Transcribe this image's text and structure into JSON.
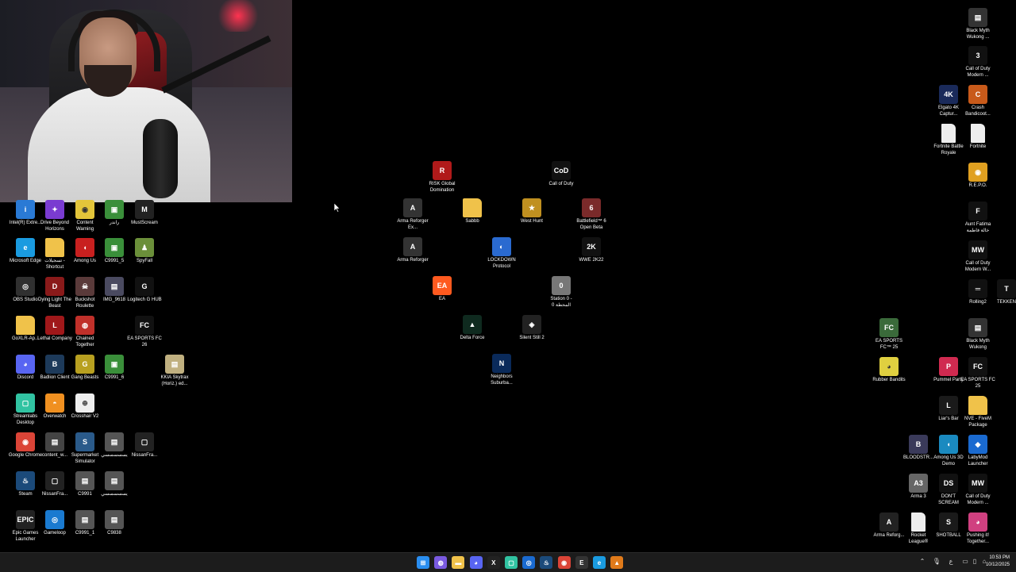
{
  "colors": {
    "desktop": "#000000",
    "taskbar": "#1c1c1c"
  },
  "left_icons": [
    {
      "label": "Intel(R) Extre...",
      "icon": "intel-icon",
      "color": "#2a7ad5",
      "glyph": "i"
    },
    {
      "label": "Drive Beyond Horizons",
      "icon": "drive-beyond-horizons-icon",
      "color": "#7a3bd1",
      "glyph": "✦"
    },
    {
      "label": "Content Warning",
      "icon": "content-warning-icon",
      "color": "#e3c53a",
      "glyph": "◉"
    },
    {
      "label": "راندر",
      "icon": "video-file-icon",
      "color": "#3a8f3a",
      "glyph": "▣"
    },
    {
      "label": "MustScream",
      "icon": "mustscream-icon",
      "color": "#222",
      "glyph": "M"
    },
    {
      "label": "Microsoft Edge",
      "icon": "edge-icon",
      "color": "#1a9be0",
      "glyph": "e"
    },
    {
      "label": "تسجيلات - Shortcut",
      "icon": "folder-icon",
      "color": "#f0c24a",
      "glyph": ""
    },
    {
      "label": "Among Us",
      "icon": "among-us-icon",
      "color": "#c8201f",
      "glyph": "◖"
    },
    {
      "label": "C9991_5",
      "icon": "video-file-icon",
      "color": "#3a8f3a",
      "glyph": "▣"
    },
    {
      "label": "SpyFall",
      "icon": "spyfall-icon",
      "color": "#6b8f3a",
      "glyph": "♟"
    },
    {
      "label": "OBS Studio",
      "icon": "obs-icon",
      "color": "#303030",
      "glyph": "◎"
    },
    {
      "label": "Dying Light The Beast",
      "icon": "dying-light-icon",
      "color": "#8a1a1a",
      "glyph": "D"
    },
    {
      "label": "Buckshot Roulette",
      "icon": "buckshot-roulette-icon",
      "color": "#5a3a3a",
      "glyph": "☠"
    },
    {
      "label": "IMG_9618",
      "icon": "image-file-icon",
      "color": "#4a4a60",
      "glyph": "▤"
    },
    {
      "label": "Logitech G HUB",
      "icon": "logitech-icon",
      "color": "#111",
      "glyph": "G"
    },
    {
      "label": "GoXLR-Ap...",
      "icon": "folder-icon",
      "color": "#f0c24a",
      "glyph": ""
    },
    {
      "label": "Lethal Company",
      "icon": "lethal-company-icon",
      "color": "#a0181a",
      "glyph": "L"
    },
    {
      "label": "Chained Together",
      "icon": "chained-together-icon",
      "color": "#c0302a",
      "glyph": "◍"
    },
    {
      "label": "EA SPORTS FC 26",
      "icon": "ea-fc-icon",
      "color": "#111",
      "glyph": "FC"
    },
    {
      "label": "Discord",
      "icon": "discord-icon",
      "color": "#5865f2",
      "glyph": "◕"
    },
    {
      "label": "Badlion Client",
      "icon": "badlion-icon",
      "color": "#1d3a5a",
      "glyph": "B"
    },
    {
      "label": "Gang Beasts",
      "icon": "gang-beasts-icon",
      "color": "#b8a020",
      "glyph": "G"
    },
    {
      "label": "C9991_6",
      "icon": "video-file-icon",
      "color": "#3a8f3a",
      "glyph": "▣"
    },
    {
      "label": "KKIA Skytrax (Horiz.) ed...",
      "icon": "video-file-icon",
      "color": "#c0b080",
      "glyph": "▤"
    },
    {
      "label": "Streamlabs Desktop",
      "icon": "streamlabs-icon",
      "color": "#31c3a2",
      "glyph": "▢"
    },
    {
      "label": "Overwatch",
      "icon": "overwatch-icon",
      "color": "#f09020",
      "glyph": "◓"
    },
    {
      "label": "Crosshair V2",
      "icon": "crosshair-icon",
      "color": "#eee",
      "glyph": "⊕"
    },
    {
      "label": "Google Chrome",
      "icon": "chrome-icon",
      "color": "#db4437",
      "glyph": "◉"
    },
    {
      "label": "content_w...",
      "icon": "video-file-icon",
      "color": "#444",
      "glyph": "▤"
    },
    {
      "label": "Supermarket Simulator",
      "icon": "supermarket-simulator-icon",
      "color": "#2a5a8a",
      "glyph": "S"
    },
    {
      "label": "يسسسسسي",
      "icon": "image-file-icon",
      "color": "#555",
      "glyph": "▤"
    },
    {
      "label": "NissanFra...",
      "icon": "video-file-icon",
      "color": "#222",
      "glyph": "▢"
    },
    {
      "label": "Steam",
      "icon": "steam-icon",
      "color": "#1b4a7a",
      "glyph": "♨"
    },
    {
      "label": "NissanFra...",
      "icon": "video-file-icon",
      "color": "#222",
      "glyph": "▢"
    },
    {
      "label": "C9991",
      "icon": "video-file-icon",
      "color": "#555",
      "glyph": "▤"
    },
    {
      "label": "يسسسسسي",
      "icon": "image-file-icon",
      "color": "#555",
      "glyph": "▤"
    },
    {
      "label": "Epic Games Launcher",
      "icon": "epic-games-icon",
      "color": "#222",
      "glyph": "EPIC"
    },
    {
      "label": "Gameloop",
      "icon": "gameloop-icon",
      "color": "#1a7ad0",
      "glyph": "◎"
    },
    {
      "label": "C9991_1",
      "icon": "video-file-icon",
      "color": "#555",
      "glyph": "▤"
    },
    {
      "label": "C9838",
      "icon": "video-file-icon",
      "color": "#555",
      "glyph": "▤"
    }
  ],
  "center_icons": [
    {
      "label": "RISK Global Domination",
      "icon": "risk-icon",
      "color": "#b01a1a",
      "glyph": "R"
    },
    {
      "label": "Call of Duty",
      "icon": "call-of-duty-icon",
      "color": "#111",
      "glyph": "CoD"
    },
    {
      "label": "Arma Reforger Ex...",
      "icon": "arma-reforger-icon",
      "color": "#333",
      "glyph": "A"
    },
    {
      "label": "Sabbb",
      "icon": "folder-icon",
      "color": "#f0c24a",
      "glyph": ""
    },
    {
      "label": "West Hunt",
      "icon": "west-hunt-icon",
      "color": "#c09020",
      "glyph": "★"
    },
    {
      "label": "Battlefield™ 6 Open Beta",
      "icon": "battlefield-icon",
      "color": "#7a2a2a",
      "glyph": "6"
    },
    {
      "label": "Arma Reforger",
      "icon": "arma-reforger-icon",
      "color": "#333",
      "glyph": "A"
    },
    {
      "label": "LOCKDOWN Protocol",
      "icon": "lockdown-protocol-icon",
      "color": "#2a6ad0",
      "glyph": "◐"
    },
    {
      "label": "WWE 2K22",
      "icon": "wwe-icon",
      "color": "#111",
      "glyph": "2K"
    },
    {
      "label": "EA",
      "icon": "ea-icon",
      "color": "#ff5a1f",
      "glyph": "EA"
    },
    {
      "label": "Station 0 - المحطة 0",
      "icon": "station-zero-icon",
      "color": "#777",
      "glyph": "0"
    },
    {
      "label": "Delta Force",
      "icon": "delta-force-icon",
      "color": "#0f2a1f",
      "glyph": "▲"
    },
    {
      "label": "Silent Still 2",
      "icon": "silent-still-icon",
      "color": "#222",
      "glyph": "◈"
    },
    {
      "label": "Neighbors Suburba...",
      "icon": "neighbors-icon",
      "color": "#0a2a5a",
      "glyph": "N"
    }
  ],
  "right_icons": [
    {
      "label": "Black Myth Wukong ...",
      "icon": "black-myth-icon",
      "color": "#333",
      "glyph": "▤"
    },
    {
      "label": "Call of Duty Modern ...",
      "icon": "call-of-duty-icon",
      "color": "#111",
      "glyph": "3"
    },
    {
      "label": "Elgato 4K Captur...",
      "icon": "elgato-icon",
      "color": "#1a2a5a",
      "glyph": "4K"
    },
    {
      "label": "Crash Bandicoot...",
      "icon": "crash-bandicoot-icon",
      "color": "#c85a1a",
      "glyph": "C"
    },
    {
      "label": "Fortnite Battle Royale",
      "icon": "file-icon",
      "color": "#eee",
      "glyph": ""
    },
    {
      "label": "Fortnite",
      "icon": "file-icon",
      "color": "#eee",
      "glyph": ""
    },
    {
      "label": "R.E.P.O.",
      "icon": "repo-icon",
      "color": "#e0a020",
      "glyph": "◉"
    },
    {
      "label": "Aunt Fatima خالة فاطمة",
      "icon": "aunt-fatima-icon",
      "color": "#111",
      "glyph": "F"
    },
    {
      "label": "Call of Duty Modern W...",
      "icon": "call-of-duty-icon",
      "color": "#111",
      "glyph": "MW"
    },
    {
      "label": "Rolling2",
      "icon": "rolling-icon",
      "color": "#111",
      "glyph": "═"
    },
    {
      "label": "TEKKEN",
      "icon": "tekken-icon",
      "color": "#111",
      "glyph": "T"
    },
    {
      "label": "EA SPORTS FC™ 25",
      "icon": "ea-fc-icon",
      "color": "#3a6a3a",
      "glyph": "FC"
    },
    {
      "label": "Black Myth Wukong",
      "icon": "black-myth-icon",
      "color": "#333",
      "glyph": "▤"
    },
    {
      "label": "Rubber Bandits",
      "icon": "rubber-bandits-icon",
      "color": "#e0d040",
      "glyph": "◕"
    },
    {
      "label": "Pummel Party",
      "icon": "pummel-party-icon",
      "color": "#d02a50",
      "glyph": "P"
    },
    {
      "label": "EA SPORTS FC 25",
      "icon": "ea-fc-icon",
      "color": "#111",
      "glyph": "FC"
    },
    {
      "label": "Liar's Bar",
      "icon": "liars-bar-icon",
      "color": "#1a1a1a",
      "glyph": "L"
    },
    {
      "label": "NVE - FiveM Package",
      "icon": "folder-icon",
      "color": "#f0c24a",
      "glyph": ""
    },
    {
      "label": "BLOODSTR...",
      "icon": "bloodstrike-icon",
      "color": "#3a3a5a",
      "glyph": "B"
    },
    {
      "label": "Among Us 3D Demo",
      "icon": "among-us-icon",
      "color": "#1a8ac0",
      "glyph": "◖"
    },
    {
      "label": "LabyMod Launcher",
      "icon": "labymod-icon",
      "color": "#1a6ad0",
      "glyph": "◆"
    },
    {
      "label": "Arma 3",
      "icon": "arma-icon",
      "color": "#666",
      "glyph": "A3"
    },
    {
      "label": "DON'T SCREAM",
      "icon": "dont-scream-icon",
      "color": "#111",
      "glyph": "DS"
    },
    {
      "label": "Call of Duty Modern ...",
      "icon": "call-of-duty-icon",
      "color": "#111",
      "glyph": "MW"
    },
    {
      "label": "Arma Reforg...",
      "icon": "arma-reforger-icon",
      "color": "#222",
      "glyph": "A"
    },
    {
      "label": "Rocket League®",
      "icon": "file-icon",
      "color": "#eee",
      "glyph": ""
    },
    {
      "label": "SHOTBALL",
      "icon": "shotball-icon",
      "color": "#1a1a1a",
      "glyph": "S"
    },
    {
      "label": "Pushing it! Together...",
      "icon": "pushing-it-icon",
      "color": "#d04080",
      "glyph": "◕"
    }
  ],
  "taskbar": {
    "apps": [
      {
        "name": "start-button",
        "color": "#2a8ef0",
        "glyph": "⊞"
      },
      {
        "name": "copilot-icon",
        "color": "#7a5ae0",
        "glyph": "◍"
      },
      {
        "name": "file-explorer-icon",
        "color": "#f0c24a",
        "glyph": "▬"
      },
      {
        "name": "discord-taskbar-icon",
        "color": "#5865f2",
        "glyph": "◕"
      },
      {
        "name": "excel-icon",
        "color": "#222",
        "glyph": "X"
      },
      {
        "name": "streamlabs-taskbar-icon",
        "color": "#31c3a2",
        "glyph": "▢"
      },
      {
        "name": "obs-taskbar-icon",
        "color": "#1a6ad0",
        "glyph": "◎"
      },
      {
        "name": "steam-taskbar-icon",
        "color": "#1b4a7a",
        "glyph": "♨"
      },
      {
        "name": "chrome-taskbar-icon",
        "color": "#db4437",
        "glyph": "◉"
      },
      {
        "name": "epic-taskbar-icon",
        "color": "#333",
        "glyph": "E"
      },
      {
        "name": "edge-taskbar-icon",
        "color": "#1a9be0",
        "glyph": "e"
      },
      {
        "name": "app-taskbar-icon",
        "color": "#e07a1a",
        "glyph": "▲"
      }
    ],
    "tray": [
      {
        "name": "chevron-up-icon",
        "glyph": "⌃"
      },
      {
        "name": "microphone-icon",
        "glyph": "🎙"
      },
      {
        "name": "language-icon",
        "glyph": "ع"
      },
      {
        "name": "notification-icon",
        "glyph": "▭"
      },
      {
        "name": "display-icon",
        "glyph": "▯"
      },
      {
        "name": "network-icon",
        "glyph": "⌂"
      },
      {
        "name": "volume-icon",
        "glyph": "◁"
      }
    ],
    "time": "10:53 PM",
    "date": "10/12/2025"
  }
}
